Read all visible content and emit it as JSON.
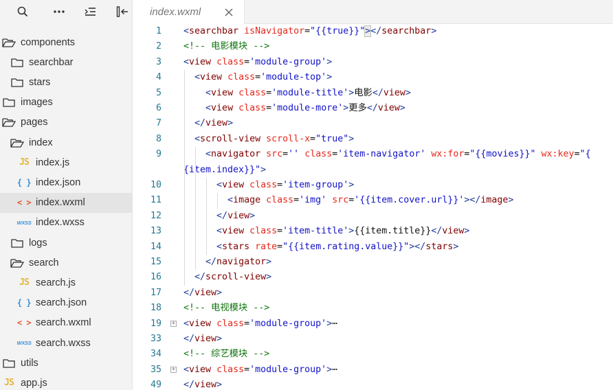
{
  "sidebar": {
    "toolbar": {
      "search_icon": "search-icon",
      "more_icon": "more-icon",
      "outline_icon": "outline-icon",
      "collapse_icon": "collapse-sidebar-icon"
    },
    "tree": [
      {
        "label": "components",
        "icon": "folder-open-icon",
        "indent": 0
      },
      {
        "label": "searchbar",
        "icon": "folder-icon",
        "indent": 1
      },
      {
        "label": "stars",
        "icon": "folder-icon",
        "indent": 1
      },
      {
        "label": "images",
        "icon": "folder-icon",
        "indent": 0
      },
      {
        "label": "pages",
        "icon": "folder-open-icon",
        "indent": 0
      },
      {
        "label": "index",
        "icon": "folder-open-icon",
        "indent": 1
      },
      {
        "label": "index.js",
        "icon": "js-file-icon",
        "indent": 2
      },
      {
        "label": "index.json",
        "icon": "json-file-icon",
        "indent": 2
      },
      {
        "label": "index.wxml",
        "icon": "wxml-file-icon",
        "indent": 2,
        "selected": true
      },
      {
        "label": "index.wxss",
        "icon": "wxss-file-icon",
        "indent": 2
      },
      {
        "label": "logs",
        "icon": "folder-icon",
        "indent": 1
      },
      {
        "label": "search",
        "icon": "folder-open-icon",
        "indent": 1
      },
      {
        "label": "search.js",
        "icon": "js-file-icon",
        "indent": 2
      },
      {
        "label": "search.json",
        "icon": "json-file-icon",
        "indent": 2
      },
      {
        "label": "search.wxml",
        "icon": "wxml-file-icon",
        "indent": 2
      },
      {
        "label": "search.wxss",
        "icon": "wxss-file-icon",
        "indent": 2
      },
      {
        "label": "utils",
        "icon": "folder-icon",
        "indent": 0
      },
      {
        "label": "app.js",
        "icon": "js-file-icon",
        "indent": 0
      }
    ],
    "icon_glyphs": {
      "js": "JS",
      "json": "{ }",
      "wxml": "< >",
      "wxss": "WXSS"
    }
  },
  "editor": {
    "tab": {
      "label": "index.wxml",
      "close_icon": "close-icon"
    },
    "lines": [
      {
        "n": "1",
        "tokens": [
          [
            "br",
            "<"
          ],
          [
            "tag",
            "searchbar"
          ],
          [
            "text",
            " "
          ],
          [
            "attr",
            "isNavigator"
          ],
          [
            "text",
            "="
          ],
          [
            "str",
            "\"{{true}}\""
          ],
          [
            "cur",
            ">"
          ],
          [
            "br",
            "</"
          ],
          [
            "tag",
            "searchbar"
          ],
          [
            "br",
            ">"
          ]
        ]
      },
      {
        "n": "2",
        "tokens": [
          [
            "com",
            "<!-- 电影模块 -->"
          ]
        ]
      },
      {
        "n": "3",
        "tokens": [
          [
            "br",
            "<"
          ],
          [
            "tag",
            "view"
          ],
          [
            "text",
            " "
          ],
          [
            "attr",
            "class"
          ],
          [
            "text",
            "="
          ],
          [
            "str",
            "'module-group'"
          ],
          [
            "br",
            ">"
          ]
        ]
      },
      {
        "n": "4",
        "tokens": [
          [
            "text",
            "  "
          ],
          [
            "br",
            "<"
          ],
          [
            "tag",
            "view"
          ],
          [
            "text",
            " "
          ],
          [
            "attr",
            "class"
          ],
          [
            "text",
            "="
          ],
          [
            "str",
            "'module-top'"
          ],
          [
            "br",
            ">"
          ]
        ]
      },
      {
        "n": "5",
        "tokens": [
          [
            "text",
            "    "
          ],
          [
            "br",
            "<"
          ],
          [
            "tag",
            "view"
          ],
          [
            "text",
            " "
          ],
          [
            "attr",
            "class"
          ],
          [
            "text",
            "="
          ],
          [
            "str",
            "'module-title'"
          ],
          [
            "br",
            ">"
          ],
          [
            "text",
            "电影"
          ],
          [
            "br",
            "</"
          ],
          [
            "tag",
            "view"
          ],
          [
            "br",
            ">"
          ]
        ]
      },
      {
        "n": "6",
        "tokens": [
          [
            "text",
            "    "
          ],
          [
            "br",
            "<"
          ],
          [
            "tag",
            "view"
          ],
          [
            "text",
            " "
          ],
          [
            "attr",
            "class"
          ],
          [
            "text",
            "="
          ],
          [
            "str",
            "'module-more'"
          ],
          [
            "br",
            ">"
          ],
          [
            "text",
            "更多"
          ],
          [
            "br",
            "</"
          ],
          [
            "tag",
            "view"
          ],
          [
            "br",
            ">"
          ]
        ]
      },
      {
        "n": "7",
        "tokens": [
          [
            "text",
            "  "
          ],
          [
            "br",
            "</"
          ],
          [
            "tag",
            "view"
          ],
          [
            "br",
            ">"
          ]
        ]
      },
      {
        "n": "8",
        "tokens": [
          [
            "text",
            "  "
          ],
          [
            "br",
            "<"
          ],
          [
            "tag",
            "scroll-view"
          ],
          [
            "text",
            " "
          ],
          [
            "attr",
            "scroll-x"
          ],
          [
            "text",
            "="
          ],
          [
            "str",
            "\"true\""
          ],
          [
            "br",
            ">"
          ]
        ]
      },
      {
        "n": "9",
        "tokens": [
          [
            "text",
            "    "
          ],
          [
            "br",
            "<"
          ],
          [
            "tag",
            "navigator"
          ],
          [
            "text",
            " "
          ],
          [
            "attr",
            "src"
          ],
          [
            "text",
            "="
          ],
          [
            "str",
            "''"
          ],
          [
            "text",
            " "
          ],
          [
            "attr",
            "class"
          ],
          [
            "text",
            "="
          ],
          [
            "str",
            "'item-navigator'"
          ],
          [
            "text",
            " "
          ],
          [
            "attr",
            "wx:for"
          ],
          [
            "text",
            "="
          ],
          [
            "str",
            "\"{{movies}}\""
          ],
          [
            "text",
            " "
          ],
          [
            "attr",
            "wx:key"
          ],
          [
            "text",
            "="
          ],
          [
            "str",
            "\"{"
          ]
        ]
      },
      {
        "n": "",
        "tokens": [
          [
            "str",
            "{item.index}}\""
          ],
          [
            "br",
            ">"
          ]
        ]
      },
      {
        "n": "10",
        "tokens": [
          [
            "text",
            "      "
          ],
          [
            "br",
            "<"
          ],
          [
            "tag",
            "view"
          ],
          [
            "text",
            " "
          ],
          [
            "attr",
            "class"
          ],
          [
            "text",
            "="
          ],
          [
            "str",
            "'item-group'"
          ],
          [
            "br",
            ">"
          ]
        ]
      },
      {
        "n": "11",
        "tokens": [
          [
            "text",
            "        "
          ],
          [
            "br",
            "<"
          ],
          [
            "tag",
            "image"
          ],
          [
            "text",
            " "
          ],
          [
            "attr",
            "class"
          ],
          [
            "text",
            "="
          ],
          [
            "str",
            "'img'"
          ],
          [
            "text",
            " "
          ],
          [
            "attr",
            "src"
          ],
          [
            "text",
            "="
          ],
          [
            "str",
            "'{{item.cover.url}}'"
          ],
          [
            "br",
            "></"
          ],
          [
            "tag",
            "image"
          ],
          [
            "br",
            ">"
          ]
        ]
      },
      {
        "n": "12",
        "tokens": [
          [
            "text",
            "      "
          ],
          [
            "br",
            "</"
          ],
          [
            "tag",
            "view"
          ],
          [
            "br",
            ">"
          ]
        ]
      },
      {
        "n": "13",
        "tokens": [
          [
            "text",
            "      "
          ],
          [
            "br",
            "<"
          ],
          [
            "tag",
            "view"
          ],
          [
            "text",
            " "
          ],
          [
            "attr",
            "class"
          ],
          [
            "text",
            "="
          ],
          [
            "str",
            "'item-title'"
          ],
          [
            "br",
            ">"
          ],
          [
            "text",
            "{{item.title}}"
          ],
          [
            "br",
            "</"
          ],
          [
            "tag",
            "view"
          ],
          [
            "br",
            ">"
          ]
        ]
      },
      {
        "n": "14",
        "tokens": [
          [
            "text",
            "      "
          ],
          [
            "br",
            "<"
          ],
          [
            "tag",
            "stars"
          ],
          [
            "text",
            " "
          ],
          [
            "attr",
            "rate"
          ],
          [
            "text",
            "="
          ],
          [
            "str",
            "\"{{item.rating.value}}\""
          ],
          [
            "br",
            "></"
          ],
          [
            "tag",
            "stars"
          ],
          [
            "br",
            ">"
          ]
        ]
      },
      {
        "n": "15",
        "tokens": [
          [
            "text",
            "    "
          ],
          [
            "br",
            "</"
          ],
          [
            "tag",
            "navigator"
          ],
          [
            "br",
            ">"
          ]
        ]
      },
      {
        "n": "16",
        "tokens": [
          [
            "text",
            "  "
          ],
          [
            "br",
            "</"
          ],
          [
            "tag",
            "scroll-view"
          ],
          [
            "br",
            ">"
          ]
        ]
      },
      {
        "n": "17",
        "tokens": [
          [
            "br",
            "</"
          ],
          [
            "tag",
            "view"
          ],
          [
            "br",
            ">"
          ]
        ]
      },
      {
        "n": "18",
        "tokens": [
          [
            "com",
            "<!-- 电视模块 -->"
          ]
        ]
      },
      {
        "n": "19",
        "fold": true,
        "tokens": [
          [
            "br",
            "<"
          ],
          [
            "tag",
            "view"
          ],
          [
            "text",
            " "
          ],
          [
            "attr",
            "class"
          ],
          [
            "text",
            "="
          ],
          [
            "str",
            "'module-group'"
          ],
          [
            "br",
            ">"
          ],
          [
            "text",
            "⋯"
          ]
        ]
      },
      {
        "n": "33",
        "tokens": [
          [
            "br",
            "</"
          ],
          [
            "tag",
            "view"
          ],
          [
            "br",
            ">"
          ]
        ]
      },
      {
        "n": "34",
        "tokens": [
          [
            "com",
            "<!-- 综艺模块 -->"
          ]
        ]
      },
      {
        "n": "35",
        "fold": true,
        "tokens": [
          [
            "br",
            "<"
          ],
          [
            "tag",
            "view"
          ],
          [
            "text",
            " "
          ],
          [
            "attr",
            "class"
          ],
          [
            "text",
            "="
          ],
          [
            "str",
            "'module-group'"
          ],
          [
            "br",
            ">"
          ],
          [
            "text",
            "⋯"
          ]
        ]
      },
      {
        "n": "49",
        "tokens": [
          [
            "br",
            "</"
          ],
          [
            "tag",
            "view"
          ],
          [
            "br",
            ">"
          ]
        ]
      }
    ]
  }
}
